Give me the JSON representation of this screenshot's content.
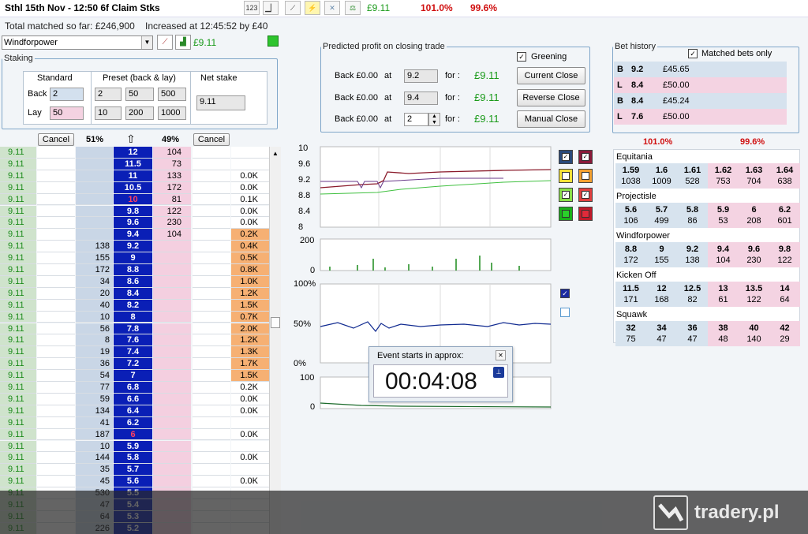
{
  "header": {
    "title": "Sthl 15th Nov - 12:50 6f Claim Stks",
    "toolbar_pl": "£9.11",
    "pct_back": "101.0%",
    "pct_lay": "99.6%",
    "matched": "Total matched so far: £246,900",
    "increased": "Increased at 12:45:52 by £40"
  },
  "selection": {
    "runner": "Windforpower",
    "pl": "£9.11"
  },
  "staking": {
    "legend": "Staking",
    "standard_label": "Standard",
    "preset_label": "Preset (back & lay)",
    "net_label": "Net stake",
    "back_label": "Back",
    "lay_label": "Lay",
    "back_std": "2",
    "lay_std": "50",
    "back_presets": [
      "2",
      "50",
      "500"
    ],
    "lay_presets": [
      "10",
      "200",
      "1000"
    ],
    "net_value": "9.11"
  },
  "closing": {
    "legend": "Predicted profit on closing trade",
    "greening_label": "Greening",
    "rows": [
      {
        "label": "Back £0.00",
        "at": "at",
        "price": "9.2",
        "for": "for :",
        "profit": "£9.11",
        "button": "Current Close"
      },
      {
        "label": "Back £0.00",
        "at": "at",
        "price": "9.4",
        "for": "for :",
        "profit": "£9.11",
        "button": "Reverse Close"
      },
      {
        "label": "Back £0.00",
        "at": "at",
        "price": "2",
        "for": "for :",
        "profit": "£9.11",
        "button": "Manual Close"
      }
    ]
  },
  "bet_history": {
    "legend": "Bet history",
    "matched_only": "Matched bets only",
    "rows": [
      {
        "type": "B",
        "odds": "9.2",
        "stake": "£45.65",
        "color": "#d6e2ee"
      },
      {
        "type": "L",
        "odds": "8.4",
        "stake": "£50.00",
        "color": "#f4d3e2"
      },
      {
        "type": "B",
        "odds": "8.4",
        "stake": "£45.24",
        "color": "#d6e2ee"
      },
      {
        "type": "L",
        "odds": "7.6",
        "stake": "£50.00",
        "color": "#f4d3e2"
      }
    ]
  },
  "market_pct": {
    "back": "101.0%",
    "lay": "99.6%"
  },
  "runners": [
    {
      "name": "Equitania",
      "prices": [
        [
          "1.59",
          "1038"
        ],
        [
          "1.6",
          "1009"
        ],
        [
          "1.61",
          "528"
        ],
        [
          "1.62",
          "753"
        ],
        [
          "1.63",
          "704"
        ],
        [
          "1.64",
          "638"
        ]
      ]
    },
    {
      "name": "Projectisle",
      "prices": [
        [
          "5.6",
          "106"
        ],
        [
          "5.7",
          "499"
        ],
        [
          "5.8",
          "86"
        ],
        [
          "5.9",
          "53"
        ],
        [
          "6",
          "208"
        ],
        [
          "6.2",
          "601"
        ]
      ]
    },
    {
      "name": "Windforpower",
      "prices": [
        [
          "8.8",
          "172"
        ],
        [
          "9",
          "155"
        ],
        [
          "9.2",
          "138"
        ],
        [
          "9.4",
          "104"
        ],
        [
          "9.6",
          "230"
        ],
        [
          "9.8",
          "122"
        ]
      ]
    },
    {
      "name": "Kicken Off",
      "prices": [
        [
          "11.5",
          "171"
        ],
        [
          "12",
          "168"
        ],
        [
          "12.5",
          "82"
        ],
        [
          "13",
          "61"
        ],
        [
          "13.5",
          "122"
        ],
        [
          "14",
          "64"
        ]
      ]
    },
    {
      "name": "Squawk",
      "prices": [
        [
          "32",
          "75"
        ],
        [
          "34",
          "47"
        ],
        [
          "36",
          "47"
        ],
        [
          "38",
          "48"
        ],
        [
          "40",
          "140"
        ],
        [
          "42",
          "29"
        ]
      ]
    }
  ],
  "ladder": {
    "cancel_label": "Cancel",
    "back_pct": "51%",
    "lay_pct": "49%",
    "arrow": "⇧",
    "rows": [
      {
        "pl": "9.11",
        "back": "",
        "price": "12",
        "lay": "104",
        "vol": "",
        "hot": false
      },
      {
        "pl": "9.11",
        "back": "",
        "price": "11.5",
        "lay": "73",
        "vol": "",
        "hot": false
      },
      {
        "pl": "9.11",
        "back": "",
        "price": "11",
        "lay": "133",
        "vol": "0.0K",
        "hot": false
      },
      {
        "pl": "9.11",
        "back": "",
        "price": "10.5",
        "lay": "172",
        "vol": "0.0K",
        "hot": false
      },
      {
        "pl": "9.11",
        "back": "",
        "price": "10",
        "lay": "81",
        "vol": "0.1K",
        "hot": false,
        "red": true
      },
      {
        "pl": "9.11",
        "back": "",
        "price": "9.8",
        "lay": "122",
        "vol": "0.0K",
        "hot": false
      },
      {
        "pl": "9.11",
        "back": "",
        "price": "9.6",
        "lay": "230",
        "vol": "0.0K",
        "hot": false
      },
      {
        "pl": "9.11",
        "back": "",
        "price": "9.4",
        "lay": "104",
        "vol": "0.2K",
        "hot": true
      },
      {
        "pl": "9.11",
        "back": "138",
        "price": "9.2",
        "lay": "",
        "vol": "0.4K",
        "hot": true
      },
      {
        "pl": "9.11",
        "back": "155",
        "price": "9",
        "lay": "",
        "vol": "0.5K",
        "hot": true
      },
      {
        "pl": "9.11",
        "back": "172",
        "price": "8.8",
        "lay": "",
        "vol": "0.8K",
        "hot": true
      },
      {
        "pl": "9.11",
        "back": "34",
        "price": "8.6",
        "lay": "",
        "vol": "1.0K",
        "hot": true
      },
      {
        "pl": "9.11",
        "back": "20",
        "price": "8.4",
        "lay": "",
        "vol": "1.2K",
        "hot": true
      },
      {
        "pl": "9.11",
        "back": "40",
        "price": "8.2",
        "lay": "",
        "vol": "1.5K",
        "hot": true
      },
      {
        "pl": "9.11",
        "back": "10",
        "price": "8",
        "lay": "",
        "vol": "0.7K",
        "hot": true
      },
      {
        "pl": "9.11",
        "back": "56",
        "price": "7.8",
        "lay": "",
        "vol": "2.0K",
        "hot": true
      },
      {
        "pl": "9.11",
        "back": "8",
        "price": "7.6",
        "lay": "",
        "vol": "1.2K",
        "hot": true
      },
      {
        "pl": "9.11",
        "back": "19",
        "price": "7.4",
        "lay": "",
        "vol": "1.3K",
        "hot": true
      },
      {
        "pl": "9.11",
        "back": "36",
        "price": "7.2",
        "lay": "",
        "vol": "1.7K",
        "hot": true
      },
      {
        "pl": "9.11",
        "back": "54",
        "price": "7",
        "lay": "",
        "vol": "1.5K",
        "hot": true
      },
      {
        "pl": "9.11",
        "back": "77",
        "price": "6.8",
        "lay": "",
        "vol": "0.2K",
        "hot": false
      },
      {
        "pl": "9.11",
        "back": "59",
        "price": "6.6",
        "lay": "",
        "vol": "0.0K",
        "hot": false
      },
      {
        "pl": "9.11",
        "back": "134",
        "price": "6.4",
        "lay": "",
        "vol": "0.0K",
        "hot": false
      },
      {
        "pl": "9.11",
        "back": "41",
        "price": "6.2",
        "lay": "",
        "vol": "",
        "hot": false
      },
      {
        "pl": "9.11",
        "back": "187",
        "price": "6",
        "lay": "",
        "vol": "0.0K",
        "hot": false,
        "red": true
      },
      {
        "pl": "9.11",
        "back": "10",
        "price": "5.9",
        "lay": "",
        "vol": "",
        "hot": false
      },
      {
        "pl": "9.11",
        "back": "144",
        "price": "5.8",
        "lay": "",
        "vol": "0.0K",
        "hot": false
      },
      {
        "pl": "9.11",
        "back": "35",
        "price": "5.7",
        "lay": "",
        "vol": "",
        "hot": false
      },
      {
        "pl": "9.11",
        "back": "45",
        "price": "5.6",
        "lay": "",
        "vol": "0.0K",
        "hot": false
      },
      {
        "pl": "9.11",
        "back": "530",
        "price": "5.5",
        "lay": "",
        "vol": "",
        "hot": false
      },
      {
        "pl": "9.11",
        "back": "47",
        "price": "5.4",
        "lay": "",
        "vol": "",
        "hot": false
      },
      {
        "pl": "9.11",
        "back": "64",
        "price": "5.3",
        "lay": "",
        "vol": "",
        "hot": false
      },
      {
        "pl": "9.11",
        "back": "226",
        "price": "5.2",
        "lay": "",
        "vol": "",
        "hot": false
      }
    ]
  },
  "charts": {
    "price_ticks": [
      "10",
      "9.6",
      "9.2",
      "8.8",
      "8.4",
      "8"
    ],
    "vol_ticks": [
      "200",
      "0"
    ],
    "pct_ticks": [
      "100%",
      "50%",
      "0%"
    ],
    "vol2_ticks": [
      "100",
      "0"
    ]
  },
  "popup": {
    "title": "Event starts in approx:",
    "time": "00:04:08"
  },
  "watermark": "tradery.pl"
}
